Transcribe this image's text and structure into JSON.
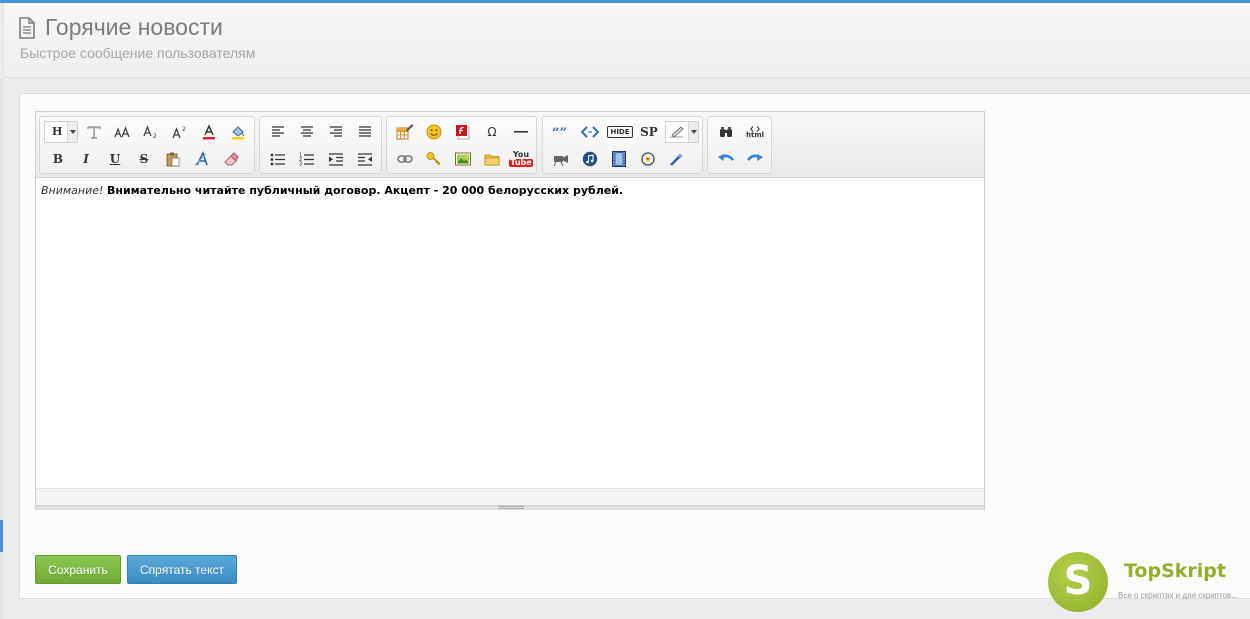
{
  "header": {
    "title": "Горячие новости",
    "subtitle": "Быстрое сообщение пользователям"
  },
  "editor": {
    "toolbar": {
      "heading_dropdown": "H",
      "bold": "B",
      "italic": "I",
      "underline": "U",
      "strike": "S",
      "omega": "Ω",
      "sp": "SP",
      "hide": "HIDE",
      "youtube_you": "You",
      "youtube_tube": "Tube",
      "html": "html"
    },
    "content": {
      "warning": "Внимание!",
      "message": "Внимательно читайте публичный договор. Акцепт - 20 000 белорусских рублей."
    }
  },
  "actions": {
    "save_label": "Сохранить",
    "hide_label": "Спрятать текст"
  },
  "watermark": {
    "letter": "S",
    "title": "TopSkript",
    "subtitle": "Все о скриптах и для скриптов..."
  },
  "colors": {
    "accent_blue": "#4a90d9",
    "save_green": "#7bb642",
    "hide_blue": "#4899d0",
    "watermark_green": "#8fb02a"
  }
}
